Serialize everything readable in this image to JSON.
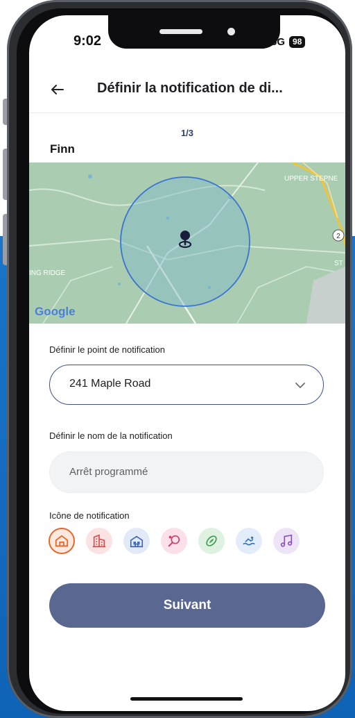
{
  "status_bar": {
    "time": "9:02",
    "network": "5G",
    "battery": "98"
  },
  "header": {
    "title": "Définir la notification de di..."
  },
  "step": "1/3",
  "child_name": "Finn",
  "map": {
    "labels": {
      "top_right": "UPPER STEPNE",
      "left": "ING RIDGE",
      "right_edge": "ST",
      "badge": "2",
      "google": "Google"
    }
  },
  "form": {
    "point_label": "Définir le point de notification",
    "point_value": "241 Maple Road",
    "name_label": "Définir le nom de la notification",
    "name_placeholder": "Arrêt programmé",
    "icon_label": "Icône de notification",
    "icons": [
      {
        "name": "home-icon",
        "color": "#e8662b",
        "bg": "#fde9dd",
        "selected": true
      },
      {
        "name": "office-building-icon",
        "color": "#d84b4b",
        "bg": "#fce3e3",
        "selected": false
      },
      {
        "name": "school-icon",
        "color": "#3d67b6",
        "bg": "#e2eaf8",
        "selected": false
      },
      {
        "name": "tennis-racket-icon",
        "color": "#c93f6a",
        "bg": "#fbe0ea",
        "selected": false
      },
      {
        "name": "football-icon",
        "color": "#3f9d4f",
        "bg": "#dff2e2",
        "selected": false
      },
      {
        "name": "swimming-icon",
        "color": "#3571c2",
        "bg": "#e3edf9",
        "selected": false
      },
      {
        "name": "music-note-icon",
        "color": "#8b4ec6",
        "bg": "#eee4f8",
        "selected": false
      }
    ]
  },
  "next_button": "Suivant",
  "colors": {
    "accent": "#5a6791",
    "border_active": "#3f4f8a",
    "map_circle": "#3b73d1"
  }
}
